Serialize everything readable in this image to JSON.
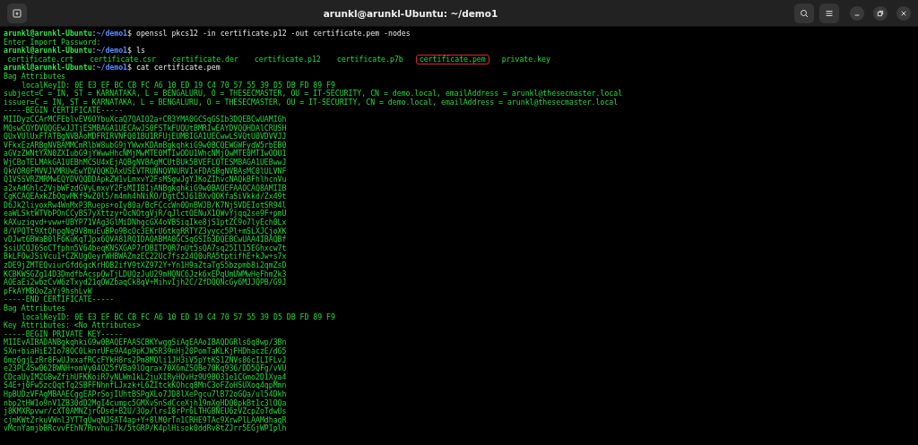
{
  "window": {
    "title": "arunkl@arunkl-Ubuntu: ~/demo1"
  },
  "lines": [
    {
      "kind": "prompt",
      "user": "arunkl@arunkl-Ubuntu",
      "separator": ":",
      "path": "~/demo1",
      "symbol": "$",
      "command": "openssl pkcs12 -in certificate.p12 -out certificate.pem -nodes"
    },
    {
      "kind": "output",
      "text": "Enter Import Password:"
    },
    {
      "kind": "prompt",
      "user": "arunkl@arunkl-Ubuntu",
      "separator": ":",
      "path": "~/demo1",
      "symbol": "$",
      "command": "ls"
    },
    {
      "kind": "listing",
      "items": [
        {
          "name": "certificate.crt",
          "highlighted": false
        },
        {
          "name": "certificate.csr",
          "highlighted": false
        },
        {
          "name": "certificate.der",
          "highlighted": false
        },
        {
          "name": "certificate.p12",
          "highlighted": false
        },
        {
          "name": "certificate.p7b",
          "highlighted": false
        },
        {
          "name": "certificate.pem",
          "highlighted": true
        },
        {
          "name": "private.key",
          "highlighted": false
        }
      ]
    },
    {
      "kind": "prompt",
      "user": "arunkl@arunkl-Ubuntu",
      "separator": ":",
      "path": "~/demo1",
      "symbol": "$",
      "command": "cat certificate.pem"
    },
    {
      "kind": "output",
      "text": "Bag Attributes"
    },
    {
      "kind": "indented",
      "text": "localKeyID: 0E E3 EF BC CB FC A6 10 ED 19 C4 70 57 55 39 D5 DB FD 89 F9"
    },
    {
      "kind": "output",
      "text": "subject=C = IN, ST = KARNATAKA, L = BENGALURU, O = THESECMASTER, OU = IT-SECURITY, CN = demo.local, emailAddress = arunkl@thesecmaster.local"
    },
    {
      "kind": "output",
      "text": "issuer=C = IN, ST = KARNATAKA, L = BENGALURU, O = THESECMASTER, OU = IT-SECURITY, CN = demo.local, emailAddress = arunkl@thesecmaster.local"
    },
    {
      "kind": "output",
      "text": "-----BEGIN CERTIFICATE-----"
    },
    {
      "kind": "output",
      "text": "MIIDyzCCArMCFEblvEV6OYbuXcaQ7QAIO2a+CR3YMA0GCSqGSIb3DQEBCwUAMIGh"
    },
    {
      "kind": "output",
      "text": "MQswCQYDVQQGEwJJTjESMBAGA1UECAwJS0FSTkFUQUtBMRIwEAYDVQQHDAlCRUSH"
    },
    {
      "kind": "output",
      "text": "QUxVUlUxFTATBgNVBAoMDFRIRVNFQ01BU1RFUjEUMBIGA1UECwwLSVQtU0VDVVJJ"
    },
    {
      "kind": "output",
      "text": "VFkxEzARBgNVBAMMCmRlbW8ubG9jYWwxKDAmBgkqhkiG9w0BCQEWGWFydW5rbEB0"
    },
    {
      "kind": "output",
      "text": "aGVzZWNtYXN0ZXIubG9jYWwwHhcNMjMwMTE0MTIwODU1WhcNMjQwMTE0MTIwODU1"
    },
    {
      "kind": "output",
      "text": "WjCBoTELMAkGA1UEBhMCSU4xEjAQBgNVBAgMCUtBUk5BVEFLQTESMBAGA1UEBwwJ"
    },
    {
      "kind": "output",
      "text": "QkVOR0FMVVJVMRUwEwYDVQQKDAxUSEVTRUNNQVNURVIxFDASBgNVBAsMC0lULVNF"
    },
    {
      "kind": "output",
      "text": "Q1VSSVRZMRMwEQYDVQQDDApkZW1vLmxvY2FsMSgwJgYJKoZIhvcNAQkBFhlhcnVu"
    },
    {
      "kind": "output",
      "text": "a2xAdGhlc2VjbWFzdGVyLmxvY2FsMIIBIjANBgkqhkiG9w0BAQEFAAOCAQ8AMIIB"
    },
    {
      "kind": "output",
      "text": "CgKCAQEAxkZbOqvMKf9wZ0l5/m4mh4hNiKO/DgtC5J61BXvQOKfaSiVkkd/Zx49t"
    },
    {
      "kind": "output",
      "text": "D6Jk2liyoxRw4WnMxP3Rueps+oIy80a/BcFCccWn0QnBWJB/K7NjSVDEIotSR94l"
    },
    {
      "kind": "output",
      "text": "eaWLSktWTVbPOnCCyBS7yXttzy+OcNOtgVjR/qJlctOENuX1QWvYjqq2se9F+pmU"
    },
    {
      "kind": "output",
      "text": "kAXuziqvd+vww+UBYP71VAg3GlMiDNhgcGX4oVBSiqIke8jS1ptZC9o7lyEch0Lx"
    },
    {
      "kind": "output",
      "text": "8/VPQTt9XtQhpqNg9V8muEuBPo9BcOc3EKrU6tkgRRTYZ3yycc5Pl+mSLXJCjoXK"
    },
    {
      "kind": "output",
      "text": "vDJwt6BWaB0lF6KuKqTJpx6QVA81RQIDAQABMA0GCSqGSIb3DQEBCwUAA4IBAQBf"
    },
    {
      "kind": "output",
      "text": "SsiUCQJ6SoCTfphn5V64beqKNSXGAP7rDBITPQR7nUt5sQA7sq25Il15EGhxcw7t"
    },
    {
      "kind": "output",
      "text": "BkLFOwJSiVcu1+CZKUgOeyrWHBWAZmzEC22Uc7fsz24Q0uRA5tptifhE+kJw+s7x"
    },
    {
      "kind": "output",
      "text": "zDE9jZMTEQviurGfd6gcKrHOB2ifV9tXZ972Y+Yn1H9aZtaTgS5bzpmb8i2qmZsD"
    },
    {
      "kind": "output",
      "text": "KCBKWSGZg14D3DmdfbAcspQwTjLDUQzJuU29mHQNC6Jzk6xEPqUmUWMwHeFhm2k3"
    },
    {
      "kind": "output",
      "text": "AOEaEi2wbzCvW6zTxyd21qOWZbaqCk8qV+MihvIjh2C/ZfDQQNcGy6MJJQPB/G9J"
    },
    {
      "kind": "output",
      "text": "pFkAYMBOoZaYj9hshLvW"
    },
    {
      "kind": "output",
      "text": "-----END CERTIFICATE-----"
    },
    {
      "kind": "output",
      "text": "Bag Attributes"
    },
    {
      "kind": "indented",
      "text": "localKeyID: 0E E3 EF BC CB FC A6 10 ED 19 C4 70 57 55 39 D5 DB FD 89 F9"
    },
    {
      "kind": "output",
      "text": "Key Attributes: <No Attributes>"
    },
    {
      "kind": "output",
      "text": "-----BEGIN PRIVATE KEY-----"
    },
    {
      "kind": "output",
      "text": "MIIEvAIBADANBgkqhkiG9w0BAQEFAASCBKYwggSiAgEAAoIBAQDGRls6q8wp/3Bn"
    },
    {
      "kind": "output",
      "text": "SXn+biaHiE2Io78OC0LknrUFe9A4p9pKJWSR39nHj20PomTaKLKjFHDhaczE/dG5"
    },
    {
      "kind": "output",
      "text": "6mz6gjLzRr8FwUJxxafRCcFYkH8rs2Pm8MQli1JH3iV5pYtKS1ZNVs86cILIFLvJ"
    },
    {
      "kind": "output",
      "text": "e23PL4Sw062BWNH+omVy04Q25fVBa9lOqrax70X6mZSQBe70Kq936/DD5QFg/vVU"
    },
    {
      "kind": "output",
      "text": "CDcaUyIM2GBwZfihUFKKoiR7yNLWm1kL2juXIRyHQvHz9U9BO31e1CGmo2D1Xya4"
    },
    {
      "kind": "output",
      "text": "S4E+j0Fw5zcQqtTq2SBFFNhnfLJxzk+L6ZItckKOhcq8MnC3oFZoHSUXoq4qpMmn"
    },
    {
      "kind": "output",
      "text": "HpBUDzVFAgMBAAECggEAPrSojIUhtBSPgXLo7JD8lXePgcu7lB72oGQa/ul54Dkh"
    },
    {
      "kind": "output",
      "text": "nbp2tHW1o9nV1ZB30dD2MgI4cumpc5GMXvSnSdCceXjh19mXgHDQ0pkBt1c3lOQa"
    },
    {
      "kind": "output",
      "text": "j8KMXRpvwr/cXT0AMNZjrGDsd+B2U/3Op/lrsI8rPr6LTHGBNEU6zVZcpZoTdwUs"
    },
    {
      "kind": "output",
      "text": "cjmKWtZrkuVWnl3YTTqUwqNJSAT4ap+Y+8lM0rTn1CRHE9TAc9XrwPlLAAMdhaqR"
    },
    {
      "kind": "output",
      "text": "vMcnYamjbBRcvvFEhN7Rnvhui7k/5tGRP/K4plHisok0ddRv8tZJrr5EGjWPIplh"
    }
  ]
}
